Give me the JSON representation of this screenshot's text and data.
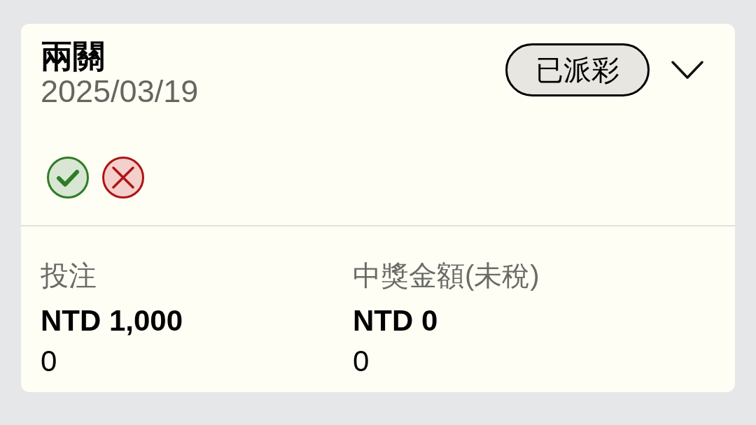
{
  "card": {
    "title": "兩關",
    "date": "2025/03/19",
    "status_badge": "已派彩",
    "expanded": false,
    "results": [
      {
        "kind": "win"
      },
      {
        "kind": "loss"
      }
    ],
    "stats": [
      {
        "label": "投注",
        "amount": "NTD 1,000",
        "value": "0"
      },
      {
        "label": "中獎金額(未稅)",
        "amount": "NTD 0",
        "value": "0"
      }
    ]
  }
}
